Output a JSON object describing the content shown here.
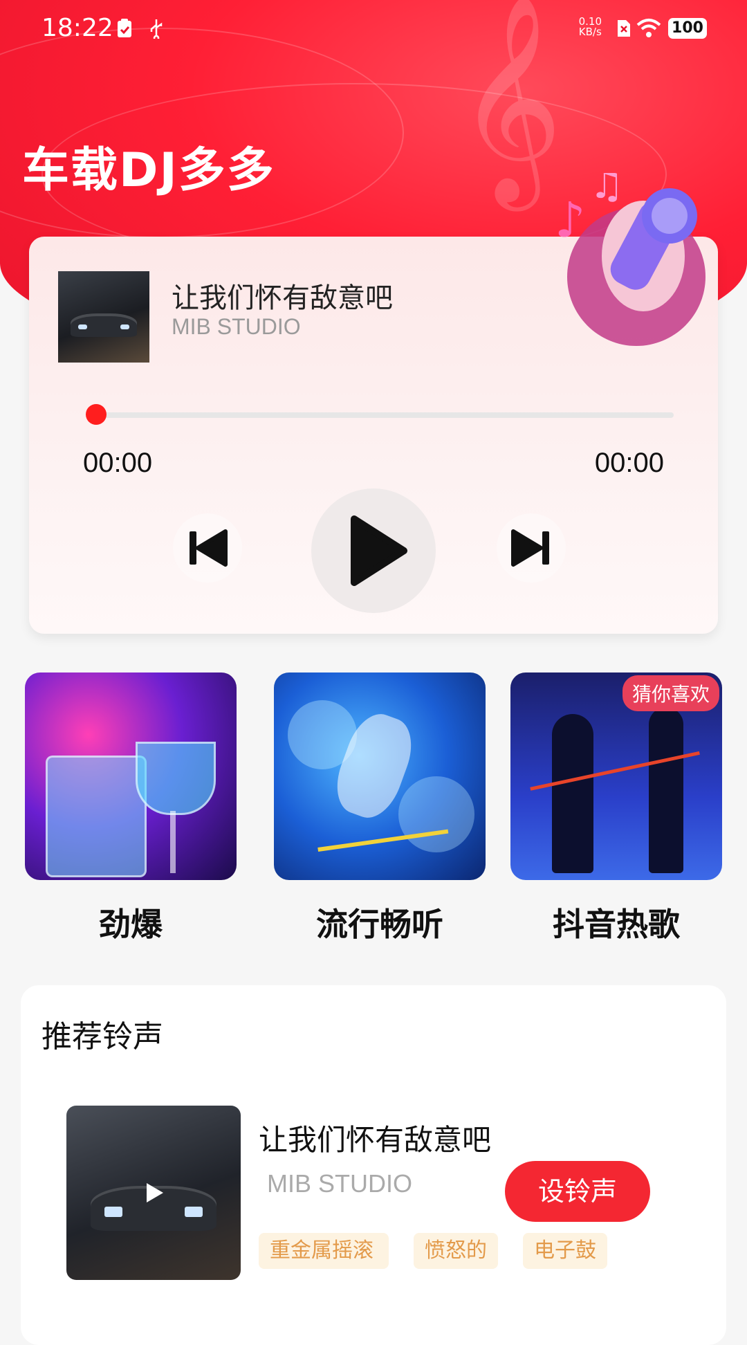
{
  "status_bar": {
    "time": "18:22",
    "net_speed_value": "0.10",
    "net_speed_unit": "KB/s",
    "battery": "100"
  },
  "app": {
    "title": "车载DJ多多"
  },
  "player": {
    "song_title": "让我们怀有敌意吧",
    "artist": "MIB STUDIO",
    "current_time": "00:00",
    "total_time": "00:00",
    "progress": 0
  },
  "categories": [
    {
      "label": "劲爆"
    },
    {
      "label": "流行畅听"
    },
    {
      "label": "抖音热歌",
      "badge": "猜你喜欢"
    }
  ],
  "ringtones": {
    "section_title": "推荐铃声",
    "item": {
      "title": "让我们怀有敌意吧",
      "artist": "MIB STUDIO",
      "button": "设铃声",
      "tags": [
        "重金属摇滚",
        "愤怒的",
        "电子鼓"
      ]
    }
  },
  "colors": {
    "accent": "#f42732",
    "hero": "#ff1f35"
  }
}
